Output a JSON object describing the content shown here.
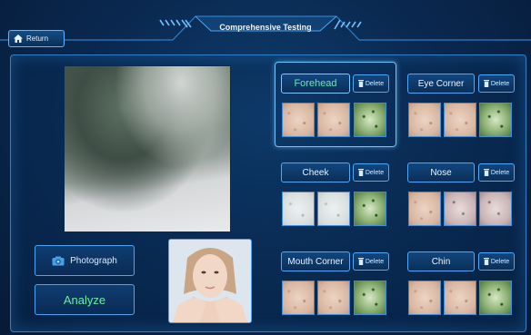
{
  "header": {
    "title": "Comprehensive Testing",
    "return_label": "Return"
  },
  "controls": {
    "photograph_label": "Photograph",
    "analyze_label": "Analyze"
  },
  "regions": [
    {
      "name": "Forehead",
      "delete_label": "Delete",
      "active": true
    },
    {
      "name": "Eye Corner",
      "delete_label": "Delete",
      "active": false
    },
    {
      "name": "Cheek",
      "delete_label": "Delete",
      "active": false
    },
    {
      "name": "Nose",
      "delete_label": "Delete",
      "active": false
    },
    {
      "name": "Mouth Corner",
      "delete_label": "Delete",
      "active": false
    },
    {
      "name": "Chin",
      "delete_label": "Delete",
      "active": false
    }
  ],
  "colors": {
    "accent": "#4fa9f7",
    "active_text": "#5ff0a1",
    "background": "#0a2a52"
  },
  "icons": {
    "return": "home-icon",
    "photograph": "camera-icon",
    "delete": "trash-icon"
  }
}
